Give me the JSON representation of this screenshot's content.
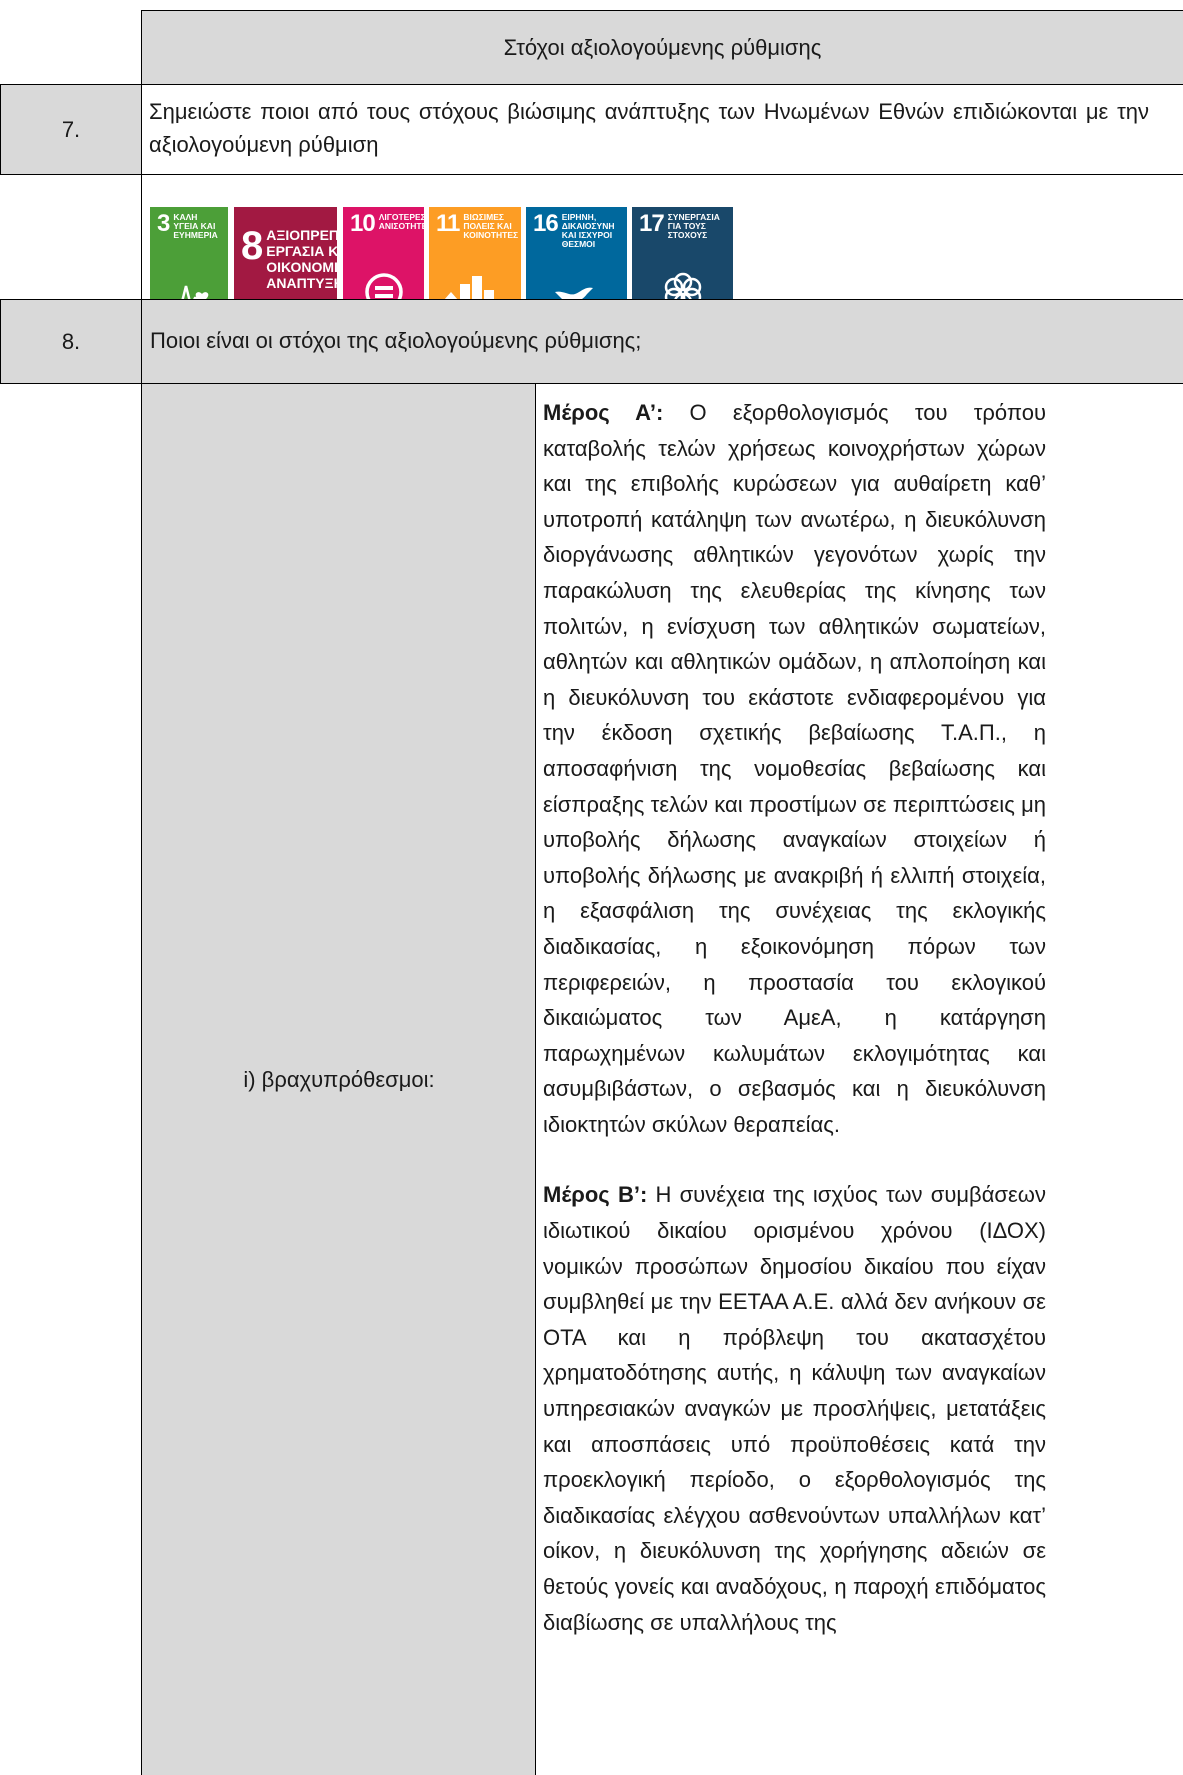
{
  "header": {
    "title": "Στόχοι αξιολογούμενης ρύθμισης"
  },
  "row7": {
    "number": "7.",
    "text": "Σημειώστε ποιοι από τους στόχους βιώσιμης ανάπτυξης των Ηνωμένων Εθνών επιδιώκονται με την αξιολογούμενη ρύθμιση"
  },
  "sdgs": [
    {
      "num": "3",
      "label": "ΚΑΛΗ ΥΓΕΙΑ ΚΑΙ ΕΥΗΜΕΡΙΑ",
      "icon": "heartbeat-icon",
      "color": "#4c9f38"
    },
    {
      "num": "8",
      "label": "ΑΞΙΟΠΡΕΠΗΣ ΕΡΓΑΣΙΑ ΚΑΙ ΟΙΚΟΝΟΜΙΚΗ ΑΝΑΠΤΥΞΗ",
      "icon": "",
      "color": "#a21942"
    },
    {
      "num": "10",
      "label": "ΛΙΓΟΤΕΡΕΣ ΑΝΙΣΟΤΗΤΕΣ",
      "icon": "equality-icon",
      "color": "#dd1367"
    },
    {
      "num": "11",
      "label": "ΒΙΩΣΙΜΕΣ ΠΟΛΕΙΣ ΚΑΙ ΚΟΙΝΟΤΗΤΕΣ",
      "icon": "city-icon",
      "color": "#fd9d24"
    },
    {
      "num": "16",
      "label": "ΕΙΡΗΝΗ, ΔΙΚΑΙΟΣΥΝΗ ΚΑΙ ΙΣΧΥΡΟΙ ΘΕΣΜΟΙ",
      "icon": "dove-icon",
      "color": "#00689d"
    },
    {
      "num": "17",
      "label": "ΣΥΝΕΡΓΑΣΙΑ ΓΙΑ ΤΟΥΣ ΣΤΟΧΟΥΣ",
      "icon": "rings-icon",
      "color": "#19486a"
    }
  ],
  "row8": {
    "number": "8.",
    "text": "Ποιοι είναι οι στόχοι της αξιολογούμενης ρύθμισης;"
  },
  "short_term": {
    "label": "i) βραχυπρόθεσμοι:",
    "part_a_heading": "Μέρος Α’:",
    "part_a_text": " Ο εξορθολογισμός του τρόπου καταβολής τελών χρήσεως κοινοχρήστων χώρων και της επιβολής κυρώσεων για αυθαίρετη καθ’ υποτροπή κατάληψη των ανωτέρω, η διευκόλυνση διοργάνωσης αθλητικών γεγονότων χωρίς την παρακώλυση της ελευθερίας της κίνησης των πολιτών, η ενίσχυση των αθλητικών σωματείων, αθλητών και αθλητικών ομάδων, η απλοποίηση και η διευκόλυνση του εκάστοτε ενδιαφερομένου για την έκδοση σχετικής βεβαίωσης Τ.Α.Π., η αποσαφήνιση της νομοθεσίας βεβαίωσης και είσπραξης τελών και προστίμων σε περιπτώσεις μη υποβολής δήλωσης αναγκαίων στοιχείων ή υποβολής δήλωσης με ανακριβή ή ελλιπή στοιχεία, η εξασφάλιση της συνέχειας της εκλογικής διαδικασίας, η εξοικονόμηση πόρων των περιφερειών, η προστασία του εκλογικού δικαιώματος των ΑμεΑ, η κατάργηση παρωχημένων κωλυμάτων εκλογιμότητας και ασυμβιβάστων, ο σεβασμός και η διευκόλυνση ιδιοκτητών σκύλων θεραπείας.",
    "part_b_heading": "Μέρος Β’:",
    "part_b_text": " Η συνέχεια της ισχύος των συμβάσεων ιδιωτικού δικαίου ορισμένου χρόνου (ΙΔΟΧ) νομικών προσώπων δημοσίου δικαίου που είχαν συμβληθεί με την ΕΕΤΑΑ Α.Ε. αλλά δεν ανήκουν σε ΟΤΑ και η πρόβλεψη του ακατασχέτου χρηματοδότησης αυτής, η κάλυψη των αναγκαίων υπηρεσιακών αναγκών με προσλήψεις, μετατάξεις και αποσπάσεις υπό προϋποθέσεις κατά την προεκλογική περίοδο, ο εξορθολογισμός της διαδικασίας ελέγχου ασθενούντων υπαλλήλων κατ’ οίκον, η διευκόλυνση της χορήγησης αδειών σε θετούς γονείς και αναδόχους, η παροχή επιδόματος διαβίωσης σε υπαλλήλους της"
  }
}
